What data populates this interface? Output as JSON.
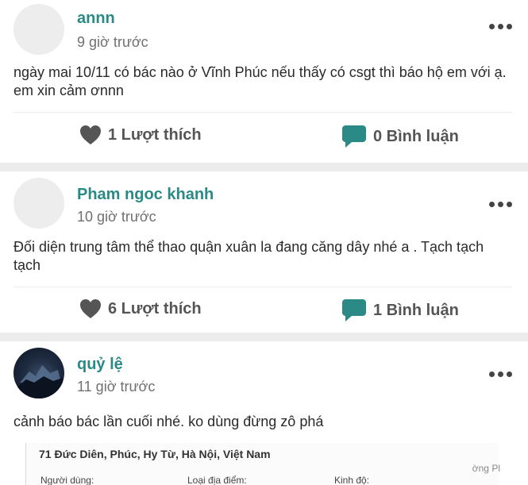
{
  "posts": [
    {
      "author": "annn",
      "time": "9 giờ trước",
      "content": "ngày mai 10/11 có bác nào ở Vĩnh Phúc nếu thấy có csgt thì báo hộ em với ạ. em xin cảm ơnnn",
      "likes": "1 Lượt thích",
      "comments": "0 Bình luận"
    },
    {
      "author": "Pham ngoc khanh",
      "time": "10 giờ trước",
      "content": "Đối diện trung tâm thể thao quận xuân la đang căng dây nhé a . Tạch tạch tạch",
      "likes": "6 Lượt thích",
      "comments": "1 Bình luận"
    },
    {
      "author": "quỷ lệ",
      "time": "11 giờ trước",
      "content": "cảnh báo bác lần cuối nhé. ko dùng đừng zô phá",
      "embed": {
        "address": "71 Đức Diên, Phúc, Hy Từ, Hà Nội, Việt Nam",
        "side_text": "ờng Pl",
        "labels": [
          "Người dùng:",
          "Loại địa điểm:",
          "Kinh độ:"
        ]
      }
    }
  ],
  "colors": {
    "author": "#2b8a86",
    "comment_icon": "#2b8a86",
    "like_icon": "#555555"
  },
  "icons": {
    "like": "heart-icon",
    "comment": "speech-bubble-icon",
    "more": "more-dots-icon"
  }
}
